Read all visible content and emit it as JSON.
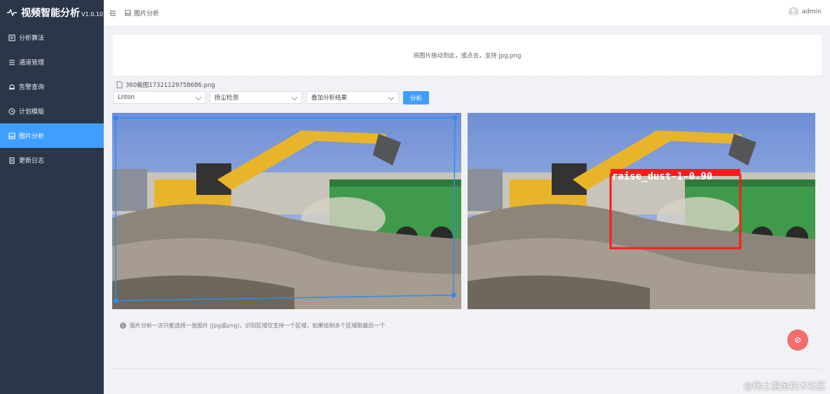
{
  "app": {
    "title": "视频智能分析",
    "version": "V1.0.10"
  },
  "sidebar": {
    "items": [
      {
        "label": "分析算法",
        "icon": "algorithm-icon",
        "active": false
      },
      {
        "label": "通道管理",
        "icon": "list-icon",
        "active": false
      },
      {
        "label": "告警查询",
        "icon": "bell-icon",
        "active": false
      },
      {
        "label": "计划模版",
        "icon": "clock-icon",
        "active": false
      },
      {
        "label": "图片分析",
        "icon": "image-icon",
        "active": true
      },
      {
        "label": "更新日志",
        "icon": "document-icon",
        "active": false
      }
    ]
  },
  "header": {
    "breadcrumb": "图片分析",
    "user": "admin"
  },
  "upload": {
    "hint": "将图片拖动到此，或点击，支持 jpg,png"
  },
  "file": {
    "name": "360截图17321129758686.png"
  },
  "controls": {
    "channel": "Lnton",
    "algorithm": "扬尘检测",
    "overlay": "叠加分析结果",
    "analyze_button": "分析"
  },
  "result": {
    "detection_label": "raise_dust-1-0.90"
  },
  "tip": "图片分析一次只能选择一张图片 (jpg或png)，识别区域仅支持一个区域，如果绘制多个区域取最后一个",
  "watermark": "@稀土掘金技术社区",
  "colors": {
    "sidebar": "#2b3648",
    "accent": "#409eff",
    "danger": "#f56c6c",
    "detection": "#ff1a1a"
  }
}
